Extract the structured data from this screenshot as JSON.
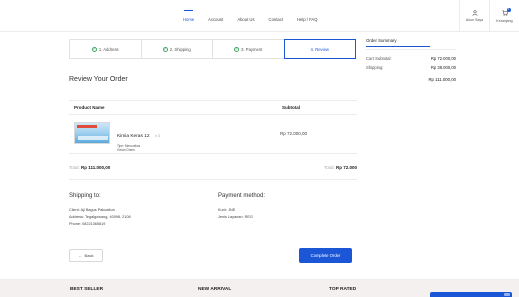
{
  "header": {
    "nav": [
      "Home",
      "Account",
      "About Us",
      "Contact",
      "Help / FAQ"
    ],
    "active_nav": "Home",
    "account_label": "Akun Saya",
    "cart_label": "Keranjang",
    "cart_count": "1"
  },
  "steps": [
    {
      "label": "1. Address",
      "done": true
    },
    {
      "label": "2. Shipping",
      "done": true
    },
    {
      "label": "3. Payment",
      "done": true
    },
    {
      "label": "4. Review",
      "done": false,
      "active": true
    }
  ],
  "summary": {
    "title": "Order Summary",
    "rows": [
      {
        "label": "Cart Subtotal:",
        "value": "Rp 72.000,00"
      },
      {
        "label": "Shipping:",
        "value": "Rp 39.000,00"
      }
    ],
    "total": "Rp 111.000,00"
  },
  "review": {
    "title": "Review Your Order",
    "col_product": "Product Name",
    "col_subtotal": "Subtotal",
    "item": {
      "name": "Kimia Keras 12",
      "qty": "x 3",
      "meta_line1": "Tipe: Menunikos",
      "meta_line2": "Gelan Dhers",
      "subtotal": "Rp 72.000,00"
    },
    "total_left_label": "Total:",
    "total_left_value": "Rp 111.000,00",
    "total_right_label": "Total:",
    "total_right_value": "Rp 72.000"
  },
  "shipping": {
    "title": "Shipping to:",
    "client_label": "Client:",
    "client_value": "Ajl Bagus Pakuattun",
    "address_label": "Address:",
    "address_value": "Tegalgowang, 40098, 2108",
    "phone_label": "Phone:",
    "phone_value": "08221365819"
  },
  "payment": {
    "title": "Payment method:",
    "kurir_label": "Kurir:",
    "kurir_value": "JNE",
    "jenis_label": "Jenis Layanan:",
    "jenis_value": "REG"
  },
  "buttons": {
    "back": "Back",
    "complete": "Complete Order"
  },
  "footer": {
    "col1": "BEST SELLER",
    "col2": "NEW ARRIVAL",
    "col3": "TOP RATED"
  },
  "colors": {
    "accent": "#1a56d6",
    "check": "#3fa564"
  }
}
